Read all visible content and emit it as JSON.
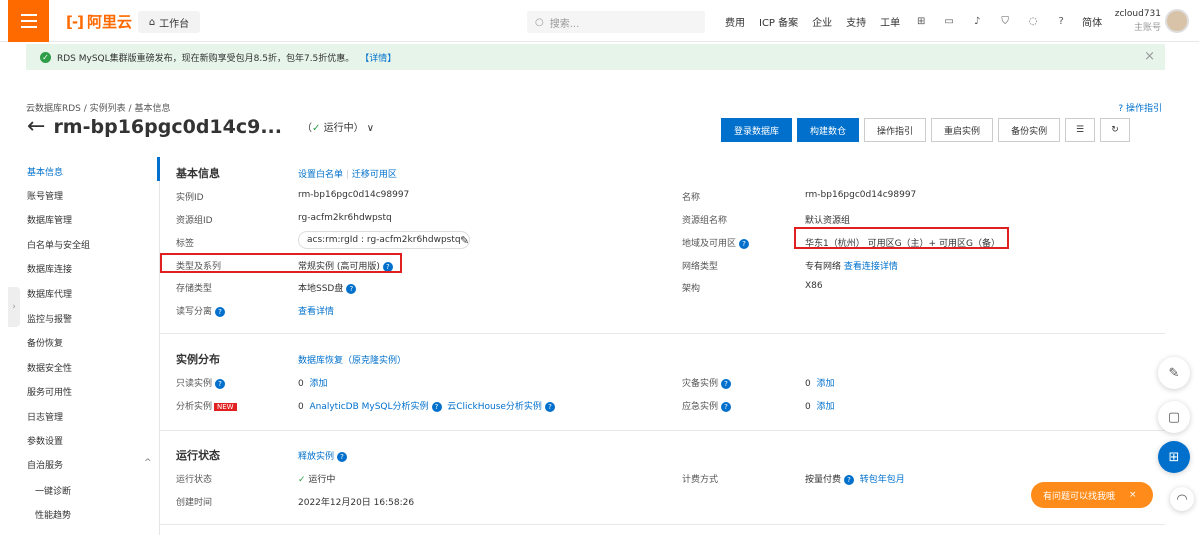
{
  "topbar": {
    "logo_text": "阿里云",
    "workbench_label": "工作台",
    "search_placeholder": "搜索...",
    "nav": [
      "费用",
      "ICP 备案",
      "企业",
      "支持",
      "工单"
    ],
    "lang": "简体",
    "user_name": "zcloud731",
    "user_role": "主账号"
  },
  "notice": {
    "text": "RDS MySQL集群版重磅发布，现在新购享受包月8.5折，包年7.5折优惠。",
    "link": "【详情】"
  },
  "breadcrumb": [
    "云数据库RDS",
    "实例列表",
    "基本信息"
  ],
  "help_label": "操作指引",
  "instance": {
    "title": "rm-bp16pgc0d14c9...",
    "status": "运行中"
  },
  "actions": [
    "登录数据库",
    "构建数仓",
    "操作指引",
    "重启实例",
    "备份实例"
  ],
  "sidebar": {
    "items": [
      "基本信息",
      "账号管理",
      "数据库管理",
      "白名单与安全组",
      "数据库连接",
      "数据库代理",
      "监控与报警",
      "备份恢复",
      "数据安全性",
      "服务可用性",
      "日志管理",
      "参数设置",
      "自治服务"
    ],
    "sub_items": [
      "一键诊断",
      "性能趋势"
    ]
  },
  "basic": {
    "title": "基本信息",
    "link1": "设置白名单",
    "link2": "迁移可用区",
    "instance_id_label": "实例ID",
    "instance_id": "rm-bp16pgc0d14c98997",
    "rg_label": "资源组ID",
    "rg": "rg-acfm2kr6hdwpstq",
    "tag_label": "标签",
    "tag": "acs:rm:rgId : rg-acfm2kr6hdwpstq",
    "type_label": "类型及系列",
    "type": "常规实例 (高可用版)",
    "storage_label": "存储类型",
    "storage": "本地SSD盘",
    "rw_label": "读写分离",
    "rw_link": "查看详情",
    "name_label": "名称",
    "name": "rm-bp16pgc0d14c98997",
    "rgname_label": "资源组名称",
    "rgname": "默认资源组",
    "region_label": "地域及可用区",
    "region": "华东1（杭州） 可用区G（主）+ 可用区G（备）",
    "net_label": "网络类型",
    "net": "专有网络",
    "net_link": "查看连接详情",
    "arch_label": "架构",
    "arch": "X86"
  },
  "distribution": {
    "title": "实例分布",
    "link": "数据库恢复（原克隆实例）",
    "ro_label": "只读实例",
    "ro_count": "0",
    "add": "添加",
    "analysis_label": "分析实例",
    "new_badge": "NEW",
    "analysis_count": "0",
    "adb_link": "AnalyticDB MySQL分析实例",
    "ch_link": "云ClickHouse分析实例",
    "dr_label": "灾备实例",
    "dr_count": "0",
    "em_label": "应急实例",
    "em_count": "0"
  },
  "runtime": {
    "title": "运行状态",
    "release_link": "释放实例",
    "status_label": "运行状态",
    "status": "运行中",
    "created_label": "创建时间",
    "created": "2022年12月20日 16:58:26",
    "billing_label": "计费方式",
    "billing": "按量付费",
    "billing_link": "转包年包月"
  },
  "chat_pill": "有问题可以找我哦"
}
